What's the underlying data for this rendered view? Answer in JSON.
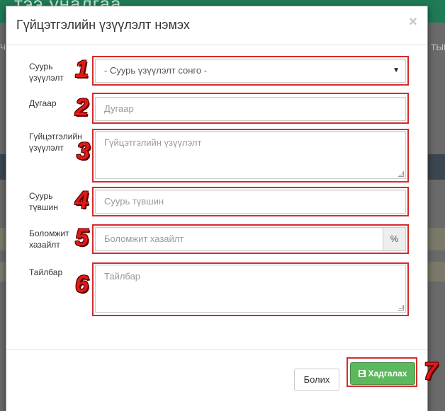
{
  "background": {
    "header_text": "тээ уналгаа",
    "edge_text": "ТЫН",
    "left_text": "ЧН"
  },
  "modal": {
    "title": "Гүйцэтгэлийн үзүүлэлт нэмэх",
    "close_glyph": "×",
    "fields": {
      "base_indicator": {
        "label_line1": "Суурь",
        "label_line2": "үзүүлэлт",
        "selected": "- Суурь үзүүлэлт сонго -"
      },
      "number": {
        "label": "Дугаар",
        "placeholder": "Дугаар"
      },
      "performance_indicator": {
        "label_line1": "Гүйцэтгэлийн",
        "label_line2": "үзүүлэлт",
        "placeholder": "Гүйцэтгэлийн үзүүлэлт"
      },
      "base_level": {
        "label_line1": "Суурь",
        "label_line2": "түвшин",
        "placeholder": "Суурь түвшин"
      },
      "possible_deviation": {
        "label_line1": "Боломжит",
        "label_line2": "хазайлт",
        "placeholder": "Боломжит хазайлт",
        "addon": "%"
      },
      "description": {
        "label": "Тайлбар",
        "placeholder": "Тайлбар"
      }
    },
    "markers": [
      "1",
      "2",
      "3",
      "4",
      "5",
      "6",
      "7"
    ],
    "footer": {
      "cancel_label": "Болих",
      "save_label": "Хадгалах"
    }
  },
  "colors": {
    "highlight": "#d62b2b",
    "success": "#5cb85c",
    "header_bg": "#1f7a55"
  }
}
